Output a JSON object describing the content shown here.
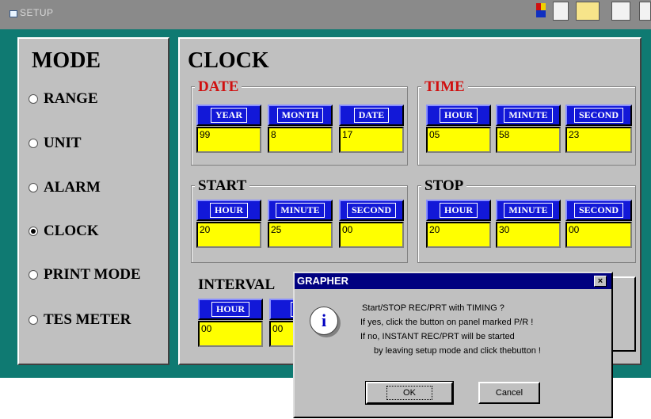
{
  "window": {
    "title": "SETUP"
  },
  "mode": {
    "title": "MODE",
    "items": [
      {
        "label": "RANGE",
        "selected": false
      },
      {
        "label": "UNIT",
        "selected": false
      },
      {
        "label": "ALARM",
        "selected": false
      },
      {
        "label": "CLOCK",
        "selected": true
      },
      {
        "label": "PRINT MODE",
        "selected": false
      },
      {
        "label": "TES METER",
        "selected": false
      }
    ]
  },
  "clock": {
    "title": "CLOCK",
    "date": {
      "title": "DATE",
      "cells": [
        {
          "label": "YEAR",
          "value": "99"
        },
        {
          "label": "MONTH",
          "value": "8"
        },
        {
          "label": "DATE",
          "value": "17"
        }
      ]
    },
    "time": {
      "title": "TIME",
      "cells": [
        {
          "label": "HOUR",
          "value": "05"
        },
        {
          "label": "MINUTE",
          "value": "58"
        },
        {
          "label": "SECOND",
          "value": "23"
        }
      ]
    },
    "start": {
      "title": "START",
      "cells": [
        {
          "label": "HOUR",
          "value": "20"
        },
        {
          "label": "MINUTE",
          "value": "25"
        },
        {
          "label": "SECOND",
          "value": "00"
        }
      ]
    },
    "stop": {
      "title": "STOP",
      "cells": [
        {
          "label": "HOUR",
          "value": "20"
        },
        {
          "label": "MINUTE",
          "value": "30"
        },
        {
          "label": "SECOND",
          "value": "00"
        }
      ]
    },
    "interval": {
      "title": "INTERVAL",
      "cells": [
        {
          "label": "HOUR",
          "value": "00"
        },
        {
          "label": "MI",
          "value": "00"
        }
      ]
    }
  },
  "dialog": {
    "title": "GRAPHER",
    "close": "×",
    "icon": "info-icon",
    "lines": [
      "Start/STOP REC/PRT with TIMING ?",
      "If yes, click the button on panel marked P/R !",
      "If no, INSTANT REC/PRT will be started",
      "by leaving setup mode and click thebutton !"
    ],
    "ok": "OK",
    "cancel": "Cancel"
  },
  "colors": {
    "teal": "#0f7a72",
    "panel": "#c0c0c0",
    "header_blue": "#1218d8",
    "value_yellow": "#ffff00",
    "title_red": "#d01010",
    "dialog_title": "#000080"
  }
}
